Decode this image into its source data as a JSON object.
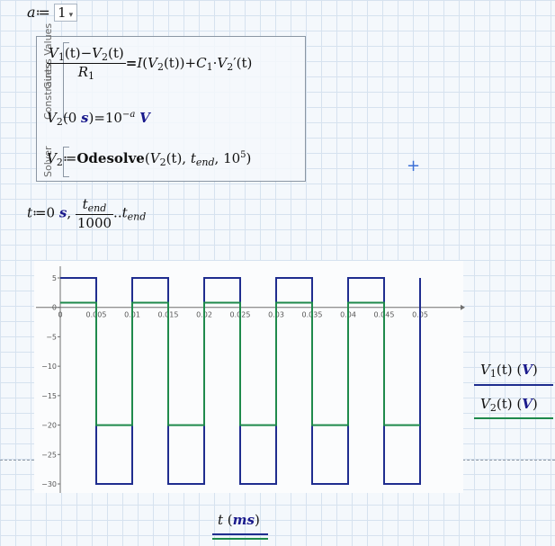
{
  "a_definition": {
    "var": "a",
    "assign": "≔",
    "value": "1"
  },
  "solve_block": {
    "labels": [
      "Guess Values",
      "Constraints",
      "Solver"
    ],
    "eq1": {
      "num": [
        "V",
        "1",
        "(t)−",
        "V",
        "2",
        "(t)"
      ],
      "den_var": "R",
      "den_sub": "1",
      "rhs": [
        "=",
        "I",
        "(",
        "V",
        "2",
        "(t))+",
        "C",
        "1",
        "·",
        "V",
        "2",
        "′(t)"
      ]
    },
    "eq2": {
      "v": "V",
      "sub": "2",
      "arg": "0 ",
      "arg_unit": "s",
      "rest": ")=10",
      "exp": "−a",
      "unit": "V"
    },
    "eq3": {
      "v": "V",
      "sub": "2",
      "assign": "≔",
      "func": "Odesolve",
      "arg1": "V",
      "arg1_sub": "2",
      "arg1_rest": "(t)",
      "arg2": "t",
      "arg2_sub": "end",
      "arg3": "10",
      "arg3_exp": "5"
    }
  },
  "t_definition": {
    "var": "t",
    "assign": "≔",
    "start": "0",
    "start_unit": "s",
    "num": "t",
    "num_sub": "end",
    "den": "1000",
    "range": "..",
    "end": "t",
    "end_sub": "end"
  },
  "colors": {
    "v1": "#1f2d8f",
    "v2": "#1f8a4c",
    "unit": "#1a1a8c"
  },
  "chart_data": {
    "type": "line",
    "x_unit": "ms",
    "xlim": [
      0,
      0.05
    ],
    "ylim": [
      -30,
      5
    ],
    "x_ticks": [
      "0",
      "0.005",
      "0.01",
      "0.015",
      "0.02",
      "0.025",
      "0.03",
      "0.035",
      "0.04",
      "0.045",
      "0.05"
    ],
    "y_ticks": [
      "5",
      "0",
      "−5",
      "−10",
      "−15",
      "−20",
      "−25",
      "−30"
    ],
    "series": [
      {
        "name": "V1(t) (V)",
        "color": "#1f2d8f",
        "x": [
          0,
          0.005,
          0.005,
          0.01,
          0.01,
          0.015,
          0.015,
          0.02,
          0.02,
          0.025,
          0.025,
          0.03,
          0.03,
          0.035,
          0.035,
          0.04,
          0.04,
          0.045,
          0.045,
          0.05,
          0.05
        ],
        "y": [
          5,
          5,
          -30,
          -30,
          5,
          5,
          -30,
          -30,
          5,
          5,
          -30,
          -30,
          5,
          5,
          -30,
          -30,
          5,
          5,
          -30,
          -30,
          5
        ]
      },
      {
        "name": "V2(t) (V)",
        "color": "#1f8a4c",
        "x": [
          0,
          0.005,
          0.005,
          0.01,
          0.01,
          0.015,
          0.015,
          0.02,
          0.02,
          0.025,
          0.025,
          0.03,
          0.03,
          0.035,
          0.035,
          0.04,
          0.04,
          0.045,
          0.045,
          0.05
        ],
        "y": [
          0.8,
          0.8,
          -20,
          -20,
          0.8,
          0.8,
          -20,
          -20,
          0.8,
          0.8,
          -20,
          -20,
          0.8,
          0.8,
          -20,
          -20,
          0.8,
          0.8,
          -20,
          -20
        ]
      }
    ],
    "legend": [
      {
        "v": "V",
        "sub": "1",
        "arg": "(t)",
        "unit": "V"
      },
      {
        "v": "V",
        "sub": "2",
        "arg": "(t)",
        "unit": "V"
      }
    ],
    "xlabel": {
      "var": "t",
      "unit": "ms"
    }
  }
}
